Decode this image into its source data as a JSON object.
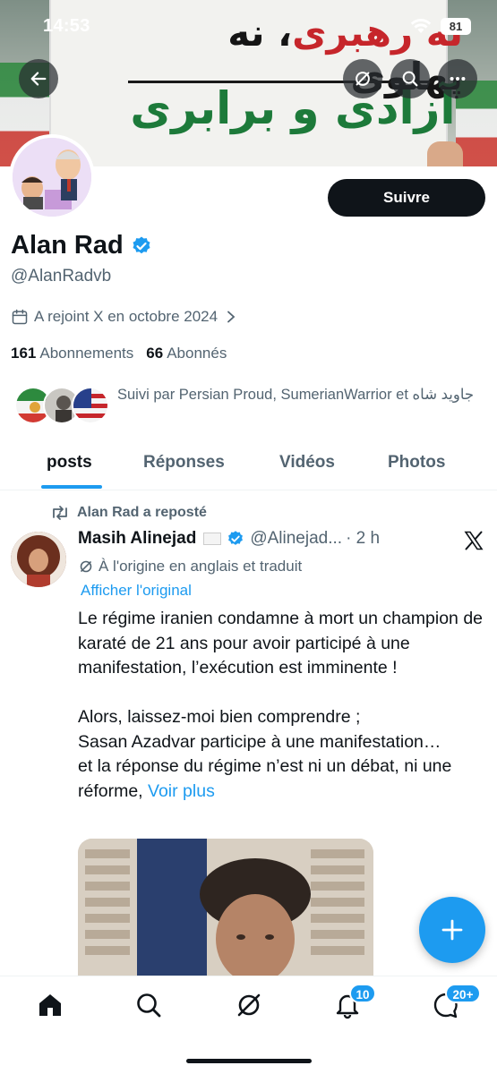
{
  "status_bar": {
    "time": "14:53",
    "battery": "81"
  },
  "banner": {
    "line1_red": "نه رهبری",
    "line1_black": "، نه پهلوی",
    "line2": "آزادی و برابری"
  },
  "profile": {
    "follow_label": "Suivre",
    "name": "Alan Rad",
    "handle": "@AlanRadvb",
    "joined": "A rejoint X en octobre 2024",
    "following_count": "161",
    "following_label": "Abonnements",
    "followers_count": "66",
    "followers_label": "Abonnés",
    "followed_by": "Suivi par Persian Proud, SumerianWarrior et جاوید شاه"
  },
  "tabs": [
    {
      "label": "posts",
      "active": true
    },
    {
      "label": "Réponses",
      "active": false
    },
    {
      "label": "Vidéos",
      "active": false
    },
    {
      "label": "Photos",
      "active": false
    }
  ],
  "post": {
    "repost_text": "Alan Rad a reposté",
    "author_name": "Masih Alinejad",
    "author_handle": "@Alinejad...",
    "time": "· 2 h",
    "translated_note": "À l'origine en anglais et traduit",
    "show_original": "Afficher l'original",
    "body": "Le régime iranien condamne à mort un champion de karaté de 21 ans pour avoir participé à une manifestation, l’exécution est imminente !\n\nAlors, laissez-moi bien comprendre ;\nSasan Azadvar participe à une manifestation…\net la réponse du régime n’est ni un débat, ni une réforme, ",
    "see_more": "Voir plus"
  },
  "bottom_nav": {
    "notifications_badge": "10",
    "messages_badge": "20+"
  },
  "colors": {
    "accent": "#1d9bf0",
    "text": "#0f1419",
    "muted": "#536471",
    "flag_green": "#1d7a3a",
    "flag_red": "#c6262b"
  }
}
